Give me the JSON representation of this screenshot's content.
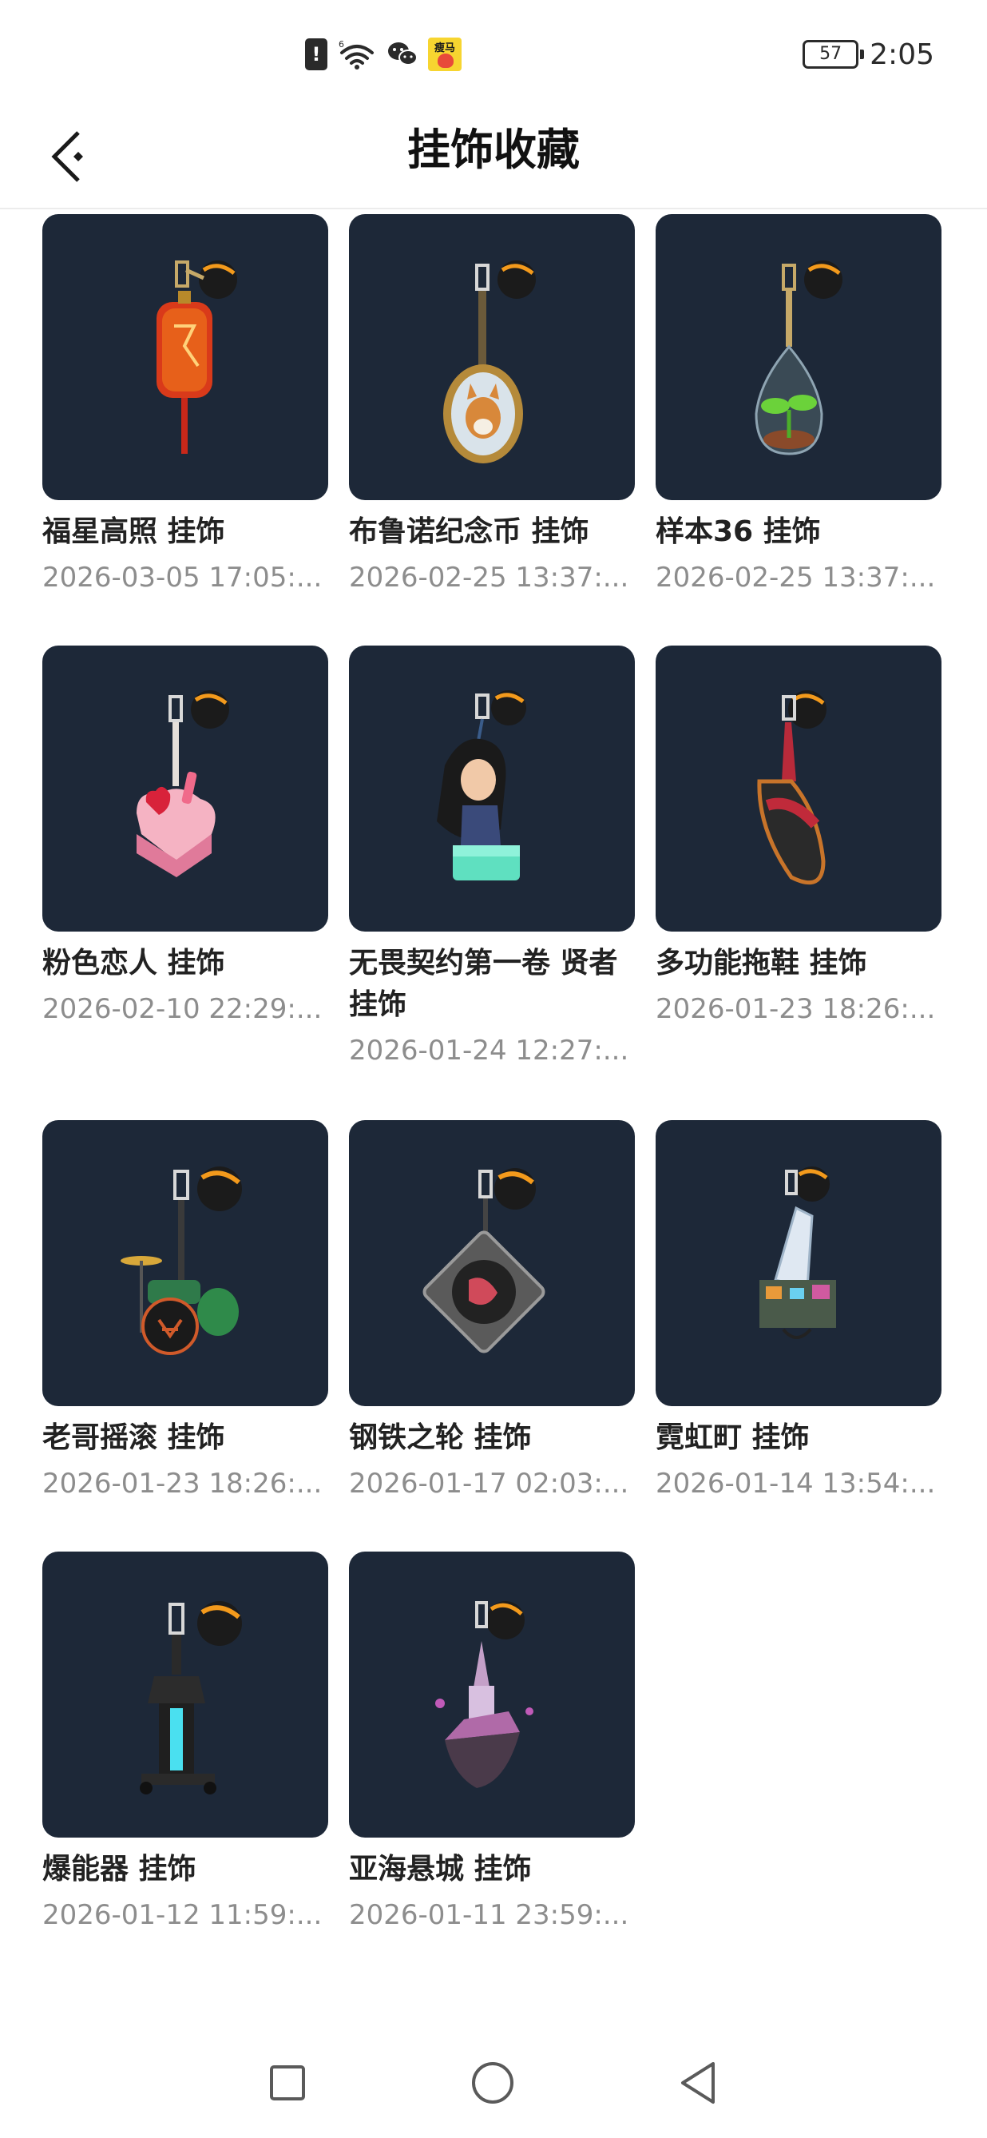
{
  "status_bar": {
    "alert_glyph": "!",
    "signal_label": "6",
    "app_badge": "瘦马",
    "battery_level": "57",
    "time": "2:05"
  },
  "header": {
    "back_icon": "back-arrow-icon",
    "title": "挂饰收藏"
  },
  "items": [
    {
      "name": "福星高照 挂饰",
      "date": "2026-03-05 17:05:...",
      "icon": "red-lantern-charm-icon"
    },
    {
      "name": "布鲁诺纪念币 挂饰",
      "date": "2026-02-25 13:37:...",
      "icon": "corgi-coin-charm-icon"
    },
    {
      "name": "样本36 挂饰",
      "date": "2026-02-25 13:37:...",
      "icon": "terrarium-sprout-charm-icon"
    },
    {
      "name": "粉色恋人 挂饰",
      "date": "2026-02-10 22:29:...",
      "icon": "pink-heart-cake-charm-icon"
    },
    {
      "name": "无畏契约第一卷 贤者 挂饰",
      "date": "2026-01-24 12:27:...",
      "icon": "sage-figure-charm-icon"
    },
    {
      "name": "多功能拖鞋 挂饰",
      "date": "2026-01-23 18:26:...",
      "icon": "slipper-charm-icon"
    },
    {
      "name": "老哥摇滚 挂饰",
      "date": "2026-01-23 18:26:...",
      "icon": "drum-kit-charm-icon"
    },
    {
      "name": "钢铁之轮 挂饰",
      "date": "2026-01-17 02:03:...",
      "icon": "turntable-charm-icon"
    },
    {
      "name": "霓虹町 挂饰",
      "date": "2026-01-14 13:54:...",
      "icon": "neon-city-charm-icon"
    },
    {
      "name": "爆能器 挂饰",
      "date": "2026-01-12 11:59:...",
      "icon": "blaster-charm-icon"
    },
    {
      "name": "亚海悬城 挂饰",
      "date": "2026-01-11 23:59:...",
      "icon": "floating-island-charm-icon"
    }
  ],
  "nav_bar": {
    "recent_icon": "square-recents-icon",
    "home_icon": "circle-home-icon",
    "back_icon": "triangle-back-icon"
  },
  "colors": {
    "thumb_bg": "#1d2838",
    "title_text": "#222222",
    "date_text": "#8d8d8d",
    "accent_orange": "#f39a1c"
  }
}
